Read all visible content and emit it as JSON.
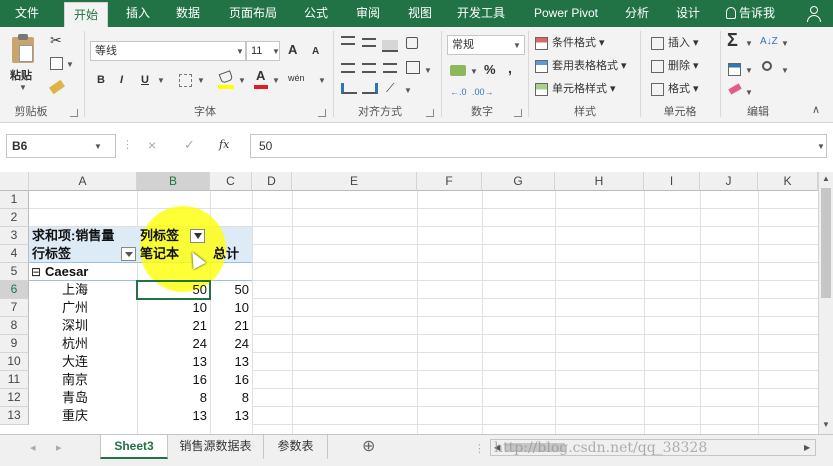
{
  "tabs": [
    "文件",
    "开始",
    "插入",
    "数据",
    "页面布局",
    "公式",
    "审阅",
    "视图",
    "开发工具",
    "Power Pivot",
    "分析",
    "设计",
    "告诉我"
  ],
  "ribbon": {
    "clipboard": {
      "paste": "粘贴",
      "label": "剪贴板"
    },
    "font": {
      "name": "等线",
      "size": "11",
      "bold": "B",
      "italic": "I",
      "underline": "U",
      "font_color": "A",
      "wen": "wén",
      "grow": "A",
      "shrink": "A",
      "label": "字体"
    },
    "align": {
      "label": "对齐方式"
    },
    "number": {
      "format": "常规",
      "percent": "%",
      "comma": ",",
      "label": "数字"
    },
    "styles": {
      "cond": "条件格式",
      "table": "套用表格格式",
      "cell": "单元格样式",
      "label": "样式"
    },
    "cells": {
      "insert": "插入",
      "delete": "删除",
      "format": "格式",
      "label": "单元格"
    },
    "edit": {
      "label": "编辑"
    }
  },
  "formula_bar": {
    "name_box": "B6",
    "fx": "fx",
    "cancel": "×",
    "enter": "✓",
    "value": "50"
  },
  "columns": [
    "A",
    "B",
    "C",
    "D",
    "E",
    "F",
    "G",
    "H",
    "I",
    "J",
    "K"
  ],
  "rows": [
    "1",
    "2",
    "3",
    "4",
    "5",
    "6",
    "7",
    "8",
    "9",
    "10",
    "11",
    "12",
    "13"
  ],
  "pivot": {
    "values_caption": "求和项:销售量",
    "col_labels": "列标签",
    "row_labels": "行标签",
    "col_item": "笔记本",
    "grand_total": "总计",
    "group": "Caesar",
    "collapse": "⊟",
    "items": [
      {
        "city": "上海",
        "b": "50",
        "c": "50"
      },
      {
        "city": "广州",
        "b": "10",
        "c": "10"
      },
      {
        "city": "深圳",
        "b": "21",
        "c": "21"
      },
      {
        "city": "杭州",
        "b": "24",
        "c": "24"
      },
      {
        "city": "大连",
        "b": "13",
        "c": "13"
      },
      {
        "city": "南京",
        "b": "16",
        "c": "16"
      },
      {
        "city": "青岛",
        "b": "8",
        "c": "8"
      },
      {
        "city": "重庆",
        "b": "13",
        "c": "13"
      }
    ]
  },
  "sheets": [
    "Sheet3",
    "销售源数据表",
    "参数表"
  ],
  "add_sheet": "⊕",
  "watermark": "http://blog.csdn.net/qq_38328",
  "colors": {
    "accent": "#217346",
    "pivot_header": "#ddebf7",
    "highlight": "#ffff00"
  }
}
